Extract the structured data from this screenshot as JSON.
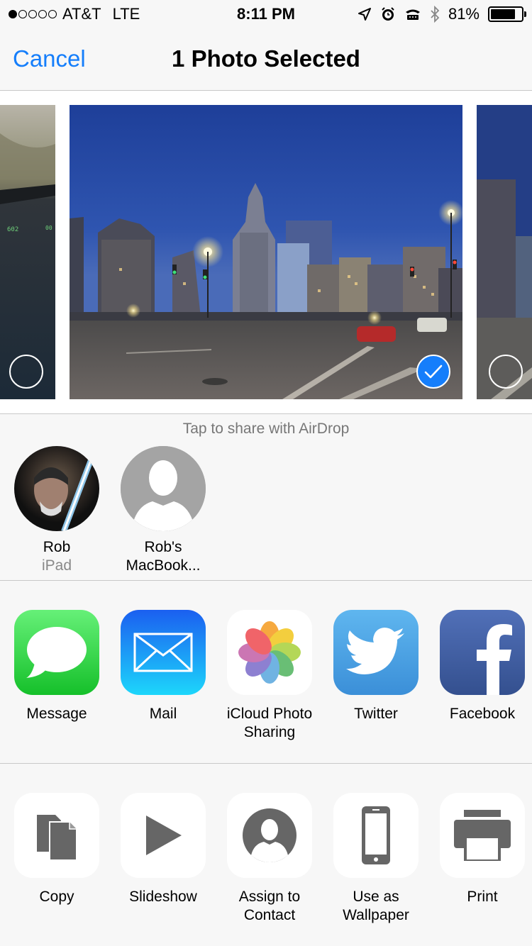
{
  "status": {
    "carrier": "AT&T",
    "network": "LTE",
    "time": "8:11 PM",
    "battery": "81%",
    "battery_level": 0.81,
    "signal_bars_filled": 1,
    "icons": [
      "location-icon",
      "alarm-icon",
      "tty-icon",
      "bluetooth-icon",
      "battery-icon"
    ]
  },
  "nav": {
    "cancel_label": "Cancel",
    "title": "1 Photo Selected"
  },
  "airdrop": {
    "hint": "Tap to share with AirDrop",
    "contacts": [
      {
        "name": "Rob",
        "device": "iPad"
      },
      {
        "name": "Rob's MacBook...",
        "device": ""
      }
    ]
  },
  "share_apps": [
    {
      "label": "Message",
      "icon": "message-icon"
    },
    {
      "label": "Mail",
      "icon": "mail-icon"
    },
    {
      "label": "iCloud Photo Sharing",
      "icon": "photos-icon"
    },
    {
      "label": "Twitter",
      "icon": "twitter-icon"
    },
    {
      "label": "Facebook",
      "icon": "facebook-icon"
    }
  ],
  "actions": [
    {
      "label": "Copy",
      "icon": "copy-icon"
    },
    {
      "label": "Slideshow",
      "icon": "play-icon"
    },
    {
      "label": "Assign to Contact",
      "icon": "contact-icon"
    },
    {
      "label": "Use as Wallpaper",
      "icon": "phone-icon"
    },
    {
      "label": "Print",
      "icon": "printer-icon"
    }
  ],
  "colors": {
    "accent": "#157efb",
    "message": "#34c84a",
    "mail": "#1a8cf7",
    "twitter": "#4aa3e8",
    "facebook": "#3b5998"
  }
}
